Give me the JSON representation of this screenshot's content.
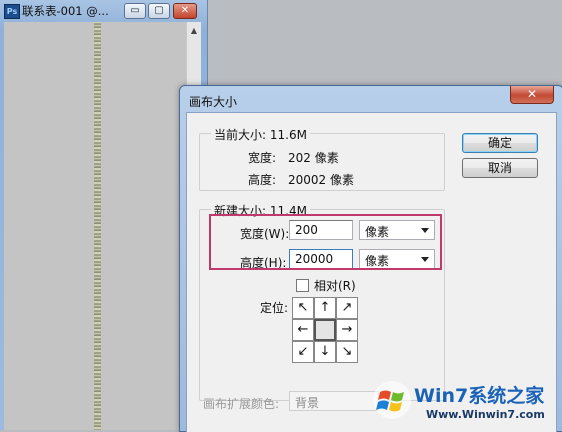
{
  "doc_window": {
    "icon": "ps-icon",
    "icon_text": "Ps",
    "title": "联系表-001 @...",
    "minimize": "▭",
    "maximize": "▢",
    "close": "✕"
  },
  "dialog": {
    "title": "画布大小",
    "close_glyph": "✕",
    "current_size": {
      "legend": "当前大小: 11.6M",
      "width_label": "宽度:",
      "width_value": "202 像素",
      "height_label": "高度:",
      "height_value": "20002 像素"
    },
    "new_size": {
      "legend": "新建大小: 11.4M",
      "width_label": "宽度(W):",
      "width_value": "200",
      "width_unit": "像素",
      "height_label": "高度(H):",
      "height_value": "20000",
      "height_unit": "像素",
      "relative_label": "相对(R)",
      "relative_checked": false,
      "anchor_label": "定位:",
      "anchor_arrows": [
        "↖",
        "↑",
        "↗",
        "←",
        "",
        "→",
        "↙",
        "↓",
        "↘"
      ]
    },
    "extension_color_label": "画布扩展颜色:",
    "extension_color_value": "背景",
    "ok_label": "确定",
    "cancel_label": "取消"
  },
  "watermark": {
    "title": "Win7系统之家",
    "url": "Www.Winwin7.com"
  },
  "colors": {
    "highlight_box": "#c0396b",
    "title_bar": "#a9c4e4",
    "watermark_blue": "#1a62b8"
  }
}
